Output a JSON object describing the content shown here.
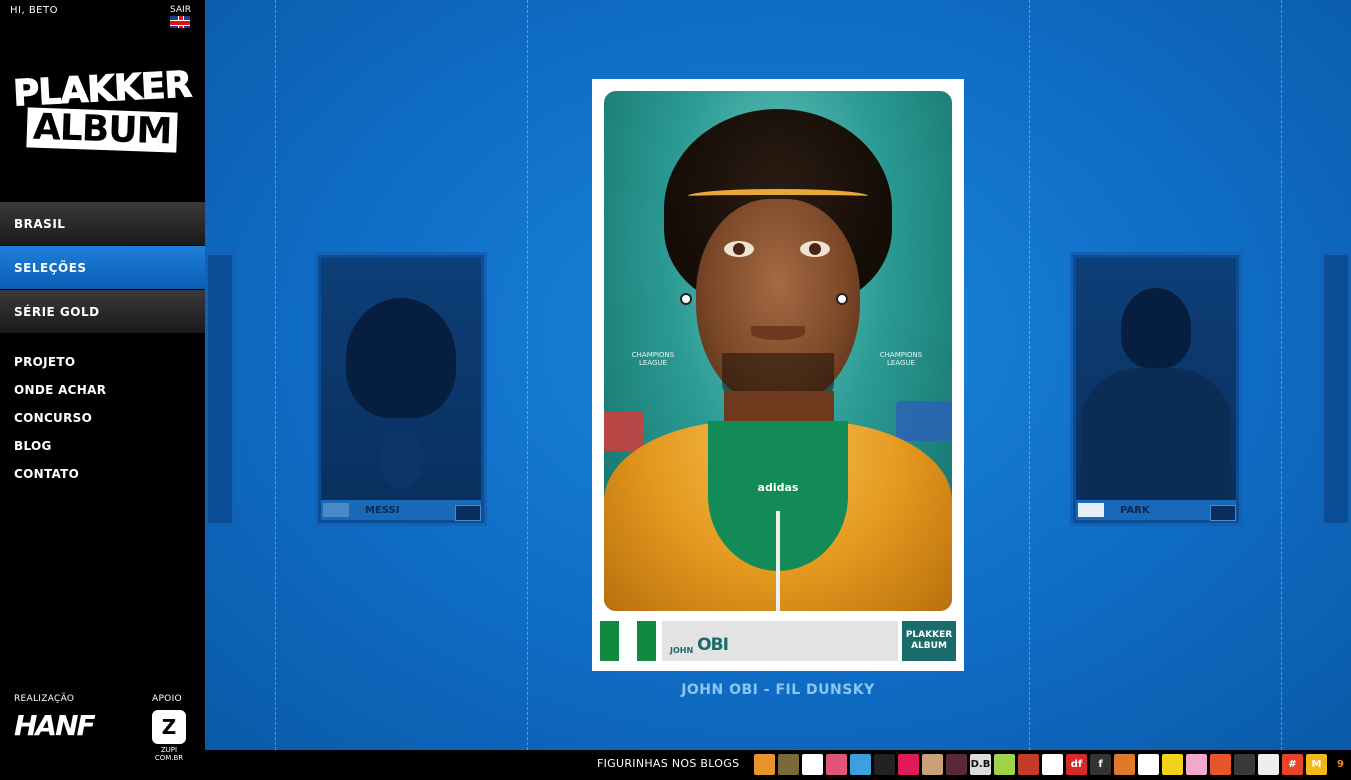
{
  "header": {
    "greeting": "HI, BETO",
    "logout": "SAIR",
    "language_flag": "uk-flag-icon"
  },
  "logo": {
    "line1": "PLAKKER",
    "line2": "ALBUM"
  },
  "nav_main": [
    {
      "label": "BRASIL",
      "active": false
    },
    {
      "label": "SELEÇÕES",
      "active": true
    },
    {
      "label": "SÉRIE GOLD",
      "active": false
    }
  ],
  "nav_sub": [
    "PROJETO",
    "ONDE ACHAR",
    "CONCURSO",
    "BLOG",
    "CONTATO"
  ],
  "credits": {
    "realizacao_label": "REALIZAÇÃO",
    "realizacao_logo": "HANF",
    "apoio_label": "APOIO",
    "apoio_logo_text": "ZUPI\nCOM.BR"
  },
  "carousel": {
    "left_card": {
      "name": "MESSI",
      "flag": "argentina"
    },
    "right_card": {
      "name": "PARK",
      "flag": "south-korea"
    },
    "featured": {
      "first_name": "JOHN",
      "last_name": "OBI",
      "flag_colors": [
        "#0f8a3e",
        "#ffffff",
        "#0f8a3e"
      ],
      "brand": "adidas",
      "badge_line1": "PLAKKER",
      "badge_line2": "ALBUM",
      "ucl_text": "CHAMPIONS LEAGUE"
    },
    "caption": "JOHN OBI - FIL DUNSKY"
  },
  "footer": {
    "label": "FIGURINHAS NOS BLOGS",
    "blog_icons": [
      {
        "text": "",
        "color": "#e8942a"
      },
      {
        "text": "",
        "color": "#7a6a3a"
      },
      {
        "text": "",
        "color": "#ffffff"
      },
      {
        "text": "",
        "color": "#e25577"
      },
      {
        "text": "",
        "color": "#3aa0e0"
      },
      {
        "text": "",
        "color": "#222222"
      },
      {
        "text": "",
        "color": "#e01b5a"
      },
      {
        "text": "",
        "color": "#c9a07a"
      },
      {
        "text": "",
        "color": "#5a2a3a"
      },
      {
        "text": "D.B",
        "color": "#dddddd"
      },
      {
        "text": "",
        "color": "#9ed34a"
      },
      {
        "text": "",
        "color": "#c63a2a"
      },
      {
        "text": "",
        "color": "#ffffff"
      },
      {
        "text": "df",
        "color": "#d62a2a"
      },
      {
        "text": "f",
        "color": "#333333"
      },
      {
        "text": "",
        "color": "#e07a2a"
      },
      {
        "text": "",
        "color": "#ffffff"
      },
      {
        "text": "",
        "color": "#f2d21a"
      },
      {
        "text": "",
        "color": "#f0a8d0"
      },
      {
        "text": "",
        "color": "#e8552a"
      },
      {
        "text": "",
        "color": "#3a3a3a"
      },
      {
        "text": "",
        "color": "#eeeeee"
      },
      {
        "text": "#",
        "color": "#e8442a"
      },
      {
        "text": "M",
        "color": "#f2b81a"
      },
      {
        "text": "9",
        "color": "#000000"
      }
    ]
  }
}
